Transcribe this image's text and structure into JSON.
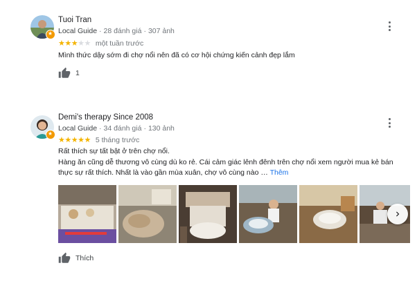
{
  "reviews": [
    {
      "author": "Tuoi Tran",
      "guide_label": "Local Guide",
      "separator": "·",
      "review_count": "28 đánh giá",
      "photo_count": "307 ảnh",
      "rating": 3,
      "rating_max": 5,
      "time": "một tuần trước",
      "text_1": "Mình thức dậy sớm đi chợ nổi nên đã có cơ hội chứng kiến cảnh đẹp lắm",
      "likes": "1"
    },
    {
      "author": "Demi's therapy Since 2008",
      "guide_label": "Local Guide",
      "separator": "·",
      "review_count": "34 đánh giá",
      "photo_count": "130 ảnh",
      "rating": 5,
      "rating_max": 5,
      "time": "5 tháng trước",
      "text_1": "Rất thích sự tất bật ở trên chợ nổi.",
      "text_2": "Hàng ăn cũng dễ thương vô cùng dù ko rẻ. Cái cảm giác lênh đênh trên chợ nổi xem người mua kẻ bán thực sự rất thích. Nhất là vào gần mùa xuân, chợ vô cùng nào ",
      "ellipsis": "…",
      "more_label": "Thêm",
      "like_label": "Thích"
    }
  ],
  "colors": {
    "star_on": "#f4b400",
    "star_off": "#dadce0",
    "link": "#1a73e8",
    "meta": "#70757a",
    "guide_badge": "#f29900"
  },
  "icons": [
    "more-vert-icon",
    "thumb-up-icon",
    "chevron-right-icon",
    "local-guide-badge-icon"
  ]
}
